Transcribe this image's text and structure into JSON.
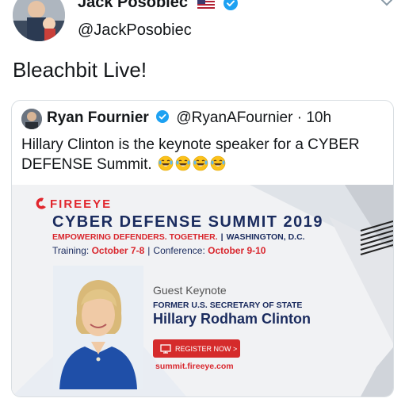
{
  "header": {
    "display_name": "Jack Posobiec",
    "flag_icon": "us-flag-icon",
    "verified_icon": "verified-badge-icon",
    "handle": "@JackPosobiec",
    "menu_icon": "chevron-down-icon"
  },
  "tweet": {
    "text": "Bleachbit Live!"
  },
  "quoted_tweet": {
    "name": "Ryan Fournier",
    "handle_time": "@RyanAFournier · 10h",
    "text": "Hillary Clinton is the keynote speaker for a CYBER DEFENSE Summit.",
    "emoji_icon": "laughing-face-icon",
    "emoji_count": 4,
    "banner": {
      "logo_text": "FIREEYE",
      "title": "CYBER DEFENSE SUMMIT 2019",
      "tagline_red": "EMPOWERING DEFENDERS. TOGETHER.",
      "tagline_sep": "|",
      "tagline_location": "WASHINGTON, D.C.",
      "training_label": "Training:",
      "training_dates": "October 7-8",
      "dates_sep": "|",
      "conference_label": "Conference:",
      "conference_dates": "October 9-10",
      "keynote_label": "Guest Keynote",
      "keynote_role": "FORMER U.S. SECRETARY OF STATE",
      "keynote_name": "Hillary Rodham Clinton",
      "register_label": "REGISTER NOW >",
      "site": "summit.fireeye.com"
    }
  },
  "colors": {
    "text": "#14171a",
    "verified": "#1da1f2",
    "fireeye_red": "#d9262d",
    "navy": "#1a2b5e",
    "border": "#d9dee2"
  }
}
